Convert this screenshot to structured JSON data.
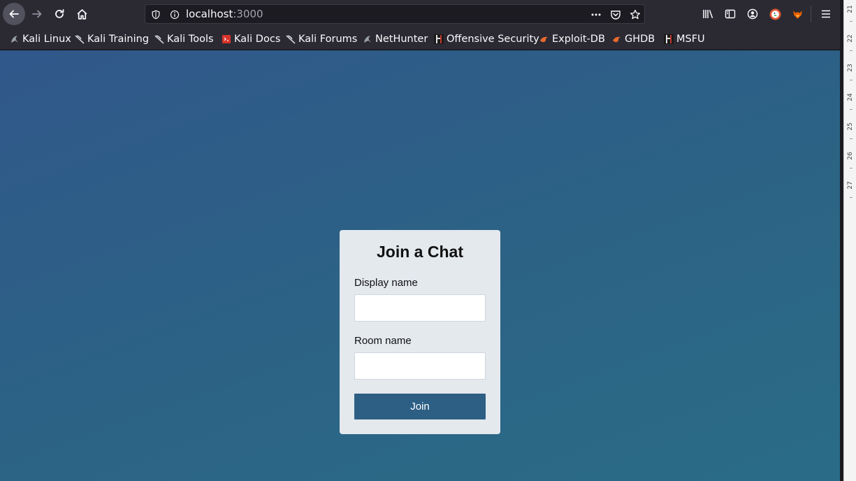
{
  "browser": {
    "url_host": "localhost",
    "url_port": ":3000",
    "bookmarks": [
      {
        "label": "Kali Linux",
        "icon": "kali-dragon-icon"
      },
      {
        "label": "Kali Training",
        "icon": "kali-dragon-icon"
      },
      {
        "label": "Kali Tools",
        "icon": "kali-dragon-icon"
      },
      {
        "label": "Kali Docs",
        "icon": "kali-docs-icon"
      },
      {
        "label": "Kali Forums",
        "icon": "kali-dragon-icon"
      },
      {
        "label": "NetHunter",
        "icon": "kali-dragon-icon"
      },
      {
        "label": "Offensive Security",
        "icon": "offsec-icon"
      },
      {
        "label": "Exploit-DB",
        "icon": "exploit-db-icon"
      },
      {
        "label": "GHDB",
        "icon": "exploit-db-icon"
      },
      {
        "label": "MSFU",
        "icon": "offsec-icon"
      }
    ]
  },
  "form": {
    "title": "Join a Chat",
    "display_name_label": "Display name",
    "display_name_value": "",
    "room_name_label": "Room name",
    "room_name_value": "",
    "join_label": "Join"
  },
  "ruler": {
    "labels": [
      "21",
      "22",
      "23",
      "24",
      "25",
      "26",
      "27"
    ]
  },
  "colors": {
    "background_top": "#30588a",
    "background_bottom": "#2a6c87",
    "card": "#e4e9ee",
    "button": "#2d5f84"
  }
}
